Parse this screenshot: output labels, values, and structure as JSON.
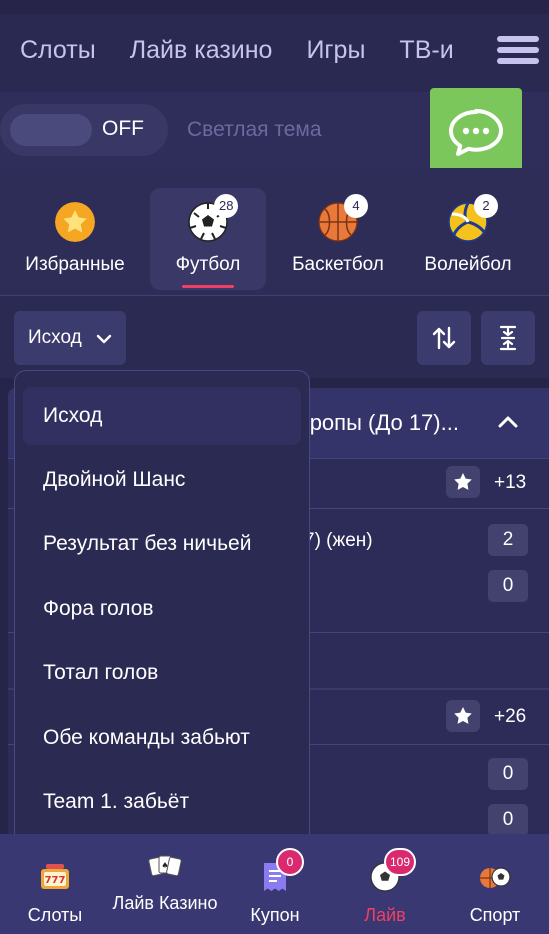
{
  "top_nav": {
    "links": [
      "Слоты",
      "Лайв казино",
      "Игры",
      "ТВ-и"
    ]
  },
  "theme": {
    "toggle_state": "OFF",
    "label": "Светлая тема"
  },
  "sports": [
    {
      "label": "Избранные",
      "icon": "star-icon",
      "badge": null,
      "active": false
    },
    {
      "label": "Футбол",
      "icon": "soccer-ball-icon",
      "badge": "28",
      "active": true
    },
    {
      "label": "Баскетбол",
      "icon": "basketball-icon",
      "badge": "4",
      "active": false
    },
    {
      "label": "Волейбол",
      "icon": "volleyball-icon",
      "badge": "2",
      "active": false
    }
  ],
  "filter": {
    "selected": "Исход",
    "sort_icon": "sort-arrows-icon",
    "collapse_all_icon": "collapse-vertical-icon"
  },
  "dropdown": {
    "options": [
      "Исход",
      "Двойной Шанс",
      "Результат без ничьей",
      "Фора голов",
      "Тотал голов",
      "Обе команды забьют",
      "Team 1. забьёт"
    ]
  },
  "content": {
    "league_title": "вропы (До 17)...",
    "match1": {
      "more": "+13",
      "team_fragment": "7) (жен)",
      "score1": "2",
      "score2": "0"
    },
    "match2": {
      "more": "+26",
      "score1": "0",
      "score2": "0"
    }
  },
  "bottom_nav": [
    {
      "label": "Слоты",
      "icon": "slots-777-icon",
      "badge": null
    },
    {
      "label": "Лайв Казино",
      "icon": "cards-icon",
      "badge": null
    },
    {
      "label": "Купон",
      "icon": "coupon-icon",
      "badge": "0"
    },
    {
      "label": "Лайв",
      "icon": "live-ball-icon",
      "badge": "109"
    },
    {
      "label": "Спорт",
      "icon": "sport-balls-icon",
      "badge": null
    }
  ],
  "colors": {
    "accent": "#ef3f64",
    "chat_green": "#7bc75b",
    "badge_pink": "#d92a6f"
  }
}
